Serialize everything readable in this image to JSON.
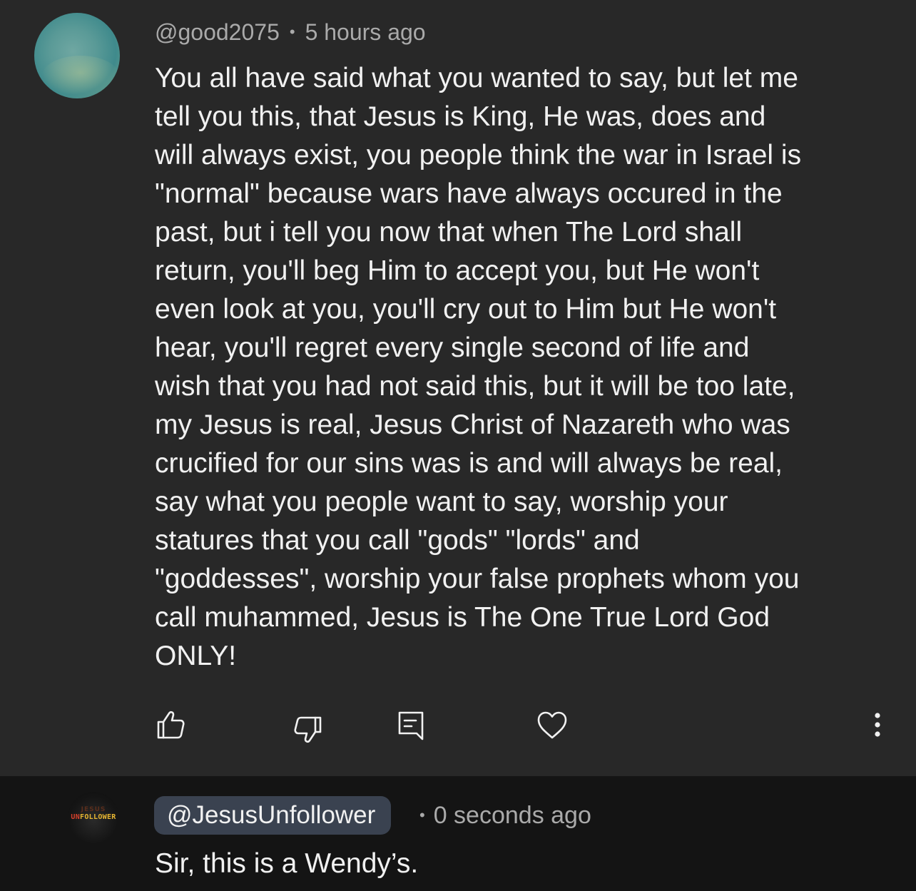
{
  "comment": {
    "author": "@good2075",
    "separator": "•",
    "time": "5 hours ago",
    "lines": [
      "You all have said what you wanted to say, but let me",
      "tell you this, that Jesus is King, He was, does and",
      "will always exist, you people think the war in Israel is",
      "\"normal\" because wars have always occured in the",
      "past, but i tell you now that when The Lord shall",
      "return, you'll beg Him to accept you, but He won't",
      "even look at you, you'll cry out to Him but He won't",
      "hear, you'll regret every single second of life and",
      "wish that you had not said this, but it will be too late,",
      "my Jesus is real, Jesus Christ of Nazareth who was",
      "crucified for our sins was is and will always be real,",
      "say what you people want to say, worship your",
      "statures that you call \"gods\" \"lords\" and",
      "\"goddesses\", worship your false prophets whom you",
      "call muhammed, Jesus is The One True Lord God",
      "ONLY!"
    ],
    "actions": {
      "like_icon": "thumbs-up-icon",
      "dislike_icon": "thumbs-down-icon",
      "reply_icon": "reply-comment-icon",
      "heart_icon": "heart-icon",
      "more_icon": "more-vertical-icon"
    }
  },
  "reply": {
    "avatar_logo_top": "JESUS",
    "avatar_logo_red": "UN",
    "avatar_logo_rest": "FOLLOWER",
    "author": "@JesusUnfollower",
    "separator": "•",
    "time": "0 seconds ago",
    "text": "Sir, this is a Wendy’s."
  },
  "colors": {
    "background": "#282828",
    "reply_background": "#141414",
    "text_primary": "#f1f1f1",
    "text_secondary": "#aaaaaa",
    "handle_chip": "#3a4250"
  }
}
